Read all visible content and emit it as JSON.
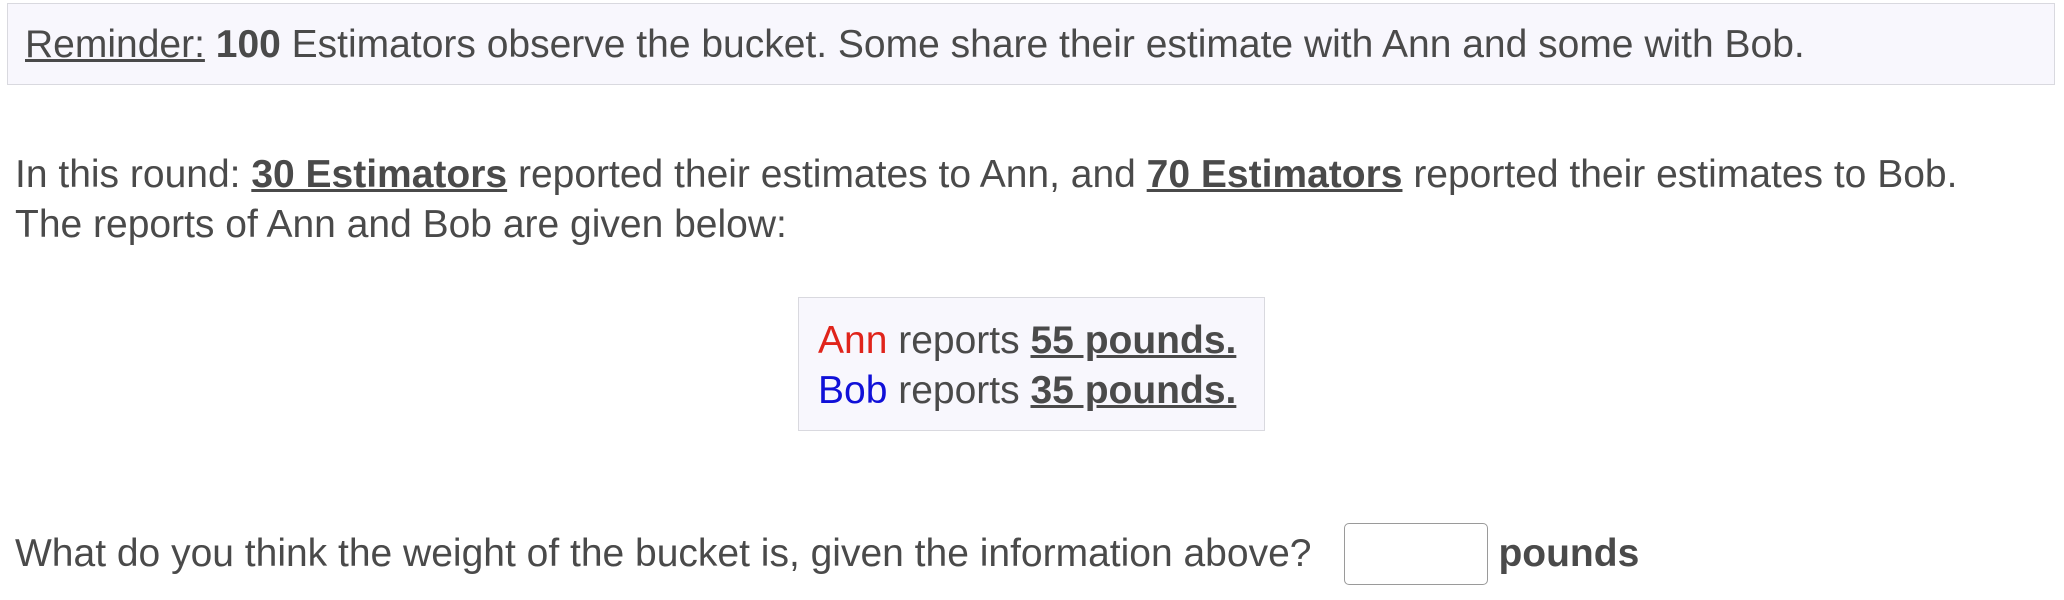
{
  "reminder": {
    "label": "Reminder:",
    "count": "100",
    "text": "Estimators observe the bucket. Some share their estimate with Ann and some with Bob."
  },
  "round": {
    "intro": "In this round:",
    "ann_count": "30 Estimators",
    "mid": "reported their estimates to Ann, and",
    "bob_count": "70 Estimators",
    "end": "reported their estimates to Bob.",
    "line2": "The reports of Ann and Bob are given below:"
  },
  "reports": [
    {
      "name": "Ann",
      "verb": "reports",
      "value": "55 pounds."
    },
    {
      "name": "Bob",
      "verb": "reports",
      "value": "35 pounds."
    }
  ],
  "question": {
    "text": "What do you think the weight of the bucket is, given the information above?",
    "input_value": "",
    "unit": "pounds"
  },
  "colors": {
    "ann": "#e0241b",
    "bob": "#1010d8",
    "text": "#4a4a4a",
    "box_background": "#f8f7fd"
  }
}
